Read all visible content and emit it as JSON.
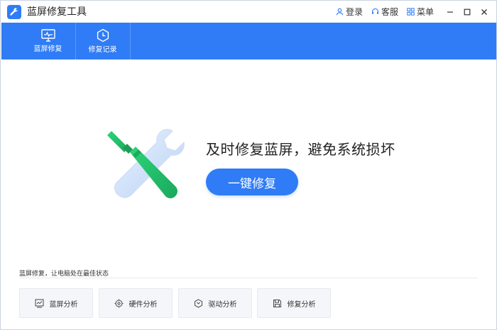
{
  "app": {
    "title": "蓝屏修复工具",
    "accent": "#2f7cf6"
  },
  "titlebar": {
    "login": "登录",
    "service": "客服",
    "menu": "菜单"
  },
  "nav": {
    "items": [
      {
        "label": "蓝屏修复",
        "icon": "monitor-icon"
      },
      {
        "label": "修复记录",
        "icon": "clock-icon"
      }
    ]
  },
  "hero": {
    "headline": "及时修复蓝屏，避免系统损坏",
    "button": "一键修复"
  },
  "footer": {
    "caption": "蓝屏修复，让电脑处在最佳状态",
    "tools": [
      {
        "label": "蓝屏分析",
        "icon": "chart-icon"
      },
      {
        "label": "硬件分析",
        "icon": "hardware-icon"
      },
      {
        "label": "驱动分析",
        "icon": "driver-icon"
      },
      {
        "label": "修复分析",
        "icon": "disk-icon"
      }
    ]
  }
}
